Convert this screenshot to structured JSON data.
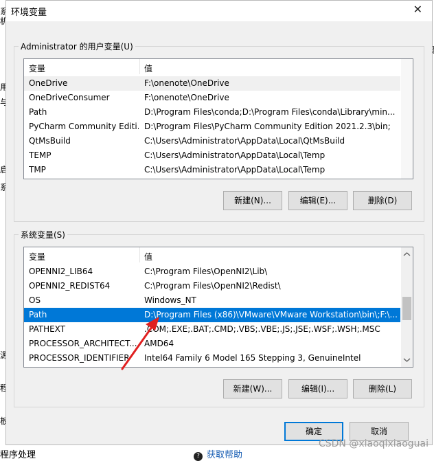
{
  "background": {
    "left_chars": [
      "系",
      "机",
      "用",
      "与",
      "启",
      "系",
      "源",
      "程",
      "板"
    ],
    "right_chars": [
      "设"
    ],
    "bottom_left": "程序处理",
    "bottom_right": "获取帮助"
  },
  "dialog": {
    "title": "环境变量",
    "close_glyph": "✕"
  },
  "user_vars": {
    "group_label": "Administrator 的用户变量(U)",
    "col_name": "变量",
    "col_value": "值",
    "rows": [
      {
        "name": "OneDrive",
        "value": "F:\\onenote\\OneDrive"
      },
      {
        "name": "OneDriveConsumer",
        "value": "F:\\onenote\\OneDrive"
      },
      {
        "name": "Path",
        "value": "D:\\Program Files\\conda;D:\\Program Files\\conda\\Library\\min..."
      },
      {
        "name": "PyCharm Community Editi...",
        "value": "D:\\Program Files\\PyCharm Community Edition 2021.2.3\\bin;"
      },
      {
        "name": "QtMsBuild",
        "value": "C:\\Users\\Administrator\\AppData\\Local\\QtMsBuild"
      },
      {
        "name": "TEMP",
        "value": "C:\\Users\\Administrator\\AppData\\Local\\Temp"
      },
      {
        "name": "TMP",
        "value": "C:\\Users\\Administrator\\AppData\\Local\\Temp"
      }
    ],
    "btn_new": "新建(N)...",
    "btn_edit": "编辑(E)...",
    "btn_delete": "删除(D)"
  },
  "system_vars": {
    "group_label": "系统变量(S)",
    "col_name": "变量",
    "col_value": "值",
    "rows": [
      {
        "name": "OPENNI2_LIB64",
        "value": "C:\\Program Files\\OpenNI2\\Lib\\"
      },
      {
        "name": "OPENNI2_REDIST64",
        "value": "C:\\Program Files\\OpenNI2\\Redist\\"
      },
      {
        "name": "OS",
        "value": "Windows_NT"
      },
      {
        "name": "Path",
        "value": "D:\\Program Files (x86)\\VMware\\VMware Workstation\\bin\\;F:\\..."
      },
      {
        "name": "PATHEXT",
        "value": ".COM;.EXE;.BAT;.CMD;.VBS;.VBE;.JS;.JSE;.WSF;.WSH;.MSC"
      },
      {
        "name": "PROCESSOR_ARCHITECT...",
        "value": "AMD64"
      },
      {
        "name": "PROCESSOR_IDENTIFIER",
        "value": "Intel64 Family 6 Model 165 Stepping 3, GenuineIntel"
      }
    ],
    "btn_new": "新建(W)...",
    "btn_edit": "编辑(I)...",
    "btn_delete": "删除(L)"
  },
  "footer": {
    "ok": "确定",
    "cancel": "取消"
  },
  "watermark": "CSDN @xiaoqixiaoguai",
  "colors": {
    "selection": "#0078d7",
    "annotation_arrow": "#e02020"
  }
}
